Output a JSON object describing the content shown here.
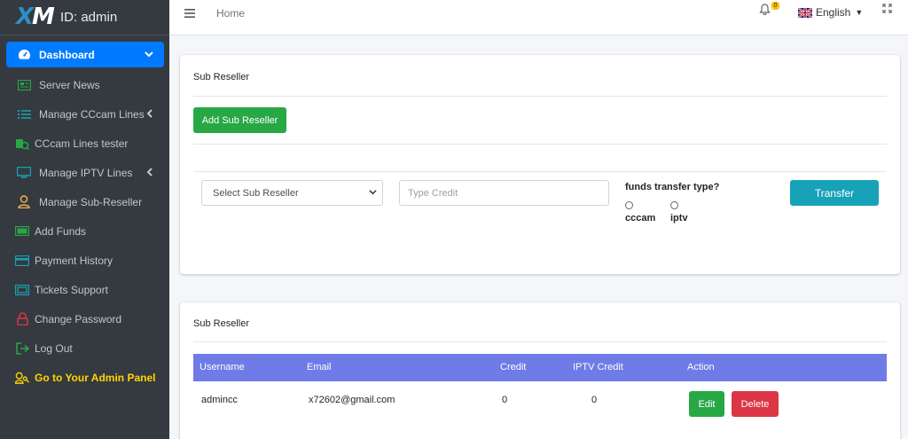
{
  "brand": {
    "logo_text": "XM",
    "title": "ID: admin"
  },
  "sidebar": {
    "items": [
      {
        "label": "Dashboard",
        "icon": "dashboard-icon"
      },
      {
        "label": "Server News",
        "icon": "news-icon"
      },
      {
        "label": "Manage CCcam Lines",
        "icon": "list-icon"
      },
      {
        "label": "CCcam Lines tester",
        "icon": "tester-icon"
      },
      {
        "label": "Manage IPTV Lines",
        "icon": "tv-icon"
      },
      {
        "label": "Manage Sub-Reseller",
        "icon": "user-icon"
      },
      {
        "label": "Add Funds",
        "icon": "money-icon"
      },
      {
        "label": "Payment History",
        "icon": "card-icon"
      },
      {
        "label": "Tickets Support",
        "icon": "ticket-icon"
      },
      {
        "label": "Change Password",
        "icon": "lock-icon"
      },
      {
        "label": "Log Out",
        "icon": "logout-icon"
      },
      {
        "label": "Go to Your Admin Panel",
        "icon": "admin-key-icon"
      }
    ]
  },
  "topbar": {
    "home": "Home",
    "notification_count": "0",
    "language": "English"
  },
  "transfer_card": {
    "title": "Sub Reseller",
    "add_button": "Add Sub Reseller",
    "select_placeholder": "Select Sub Reseller",
    "credit_placeholder": "Type Credit",
    "funds_label": "funds transfer type?",
    "radio_options": [
      "cccam",
      "iptv"
    ],
    "transfer_button": "Transfer"
  },
  "table_card": {
    "title": "Sub Reseller",
    "columns": [
      "Username",
      "Email",
      "Credit",
      "IPTV Credit",
      "Action"
    ],
    "rows": [
      {
        "username": "admincc",
        "email": "x72602@gmail.com",
        "credit": "0",
        "iptv_credit": "0",
        "edit": "Edit",
        "delete": "Delete"
      }
    ]
  },
  "colors": {
    "sidebar_bg": "#343a40",
    "active": "#007bff",
    "table_header": "#6f7be6",
    "green": "#28a745",
    "teal": "#17a2b8",
    "red": "#dc3545",
    "admin_link": "#ffd400"
  }
}
